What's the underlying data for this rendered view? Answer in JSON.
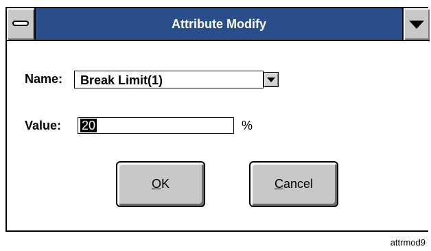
{
  "dialog": {
    "title": "Attribute Modify",
    "name_label": "Name:",
    "name_value": "Break Limit(1)",
    "value_label": "Value:",
    "value_value": "20",
    "value_unit": "%",
    "ok_mnemonic": "O",
    "ok_rest": "K",
    "cancel_mnemonic": "C",
    "cancel_rest": "ancel"
  },
  "icons": {
    "system_menu": "system-menu-icon",
    "title_dropdown": "chevron-down-icon",
    "combo_dropdown": "chevron-down-icon"
  },
  "colors": {
    "titlebar": "#2a4e8a",
    "button_face": "#c8c8c8"
  },
  "caption": "attrmod9"
}
